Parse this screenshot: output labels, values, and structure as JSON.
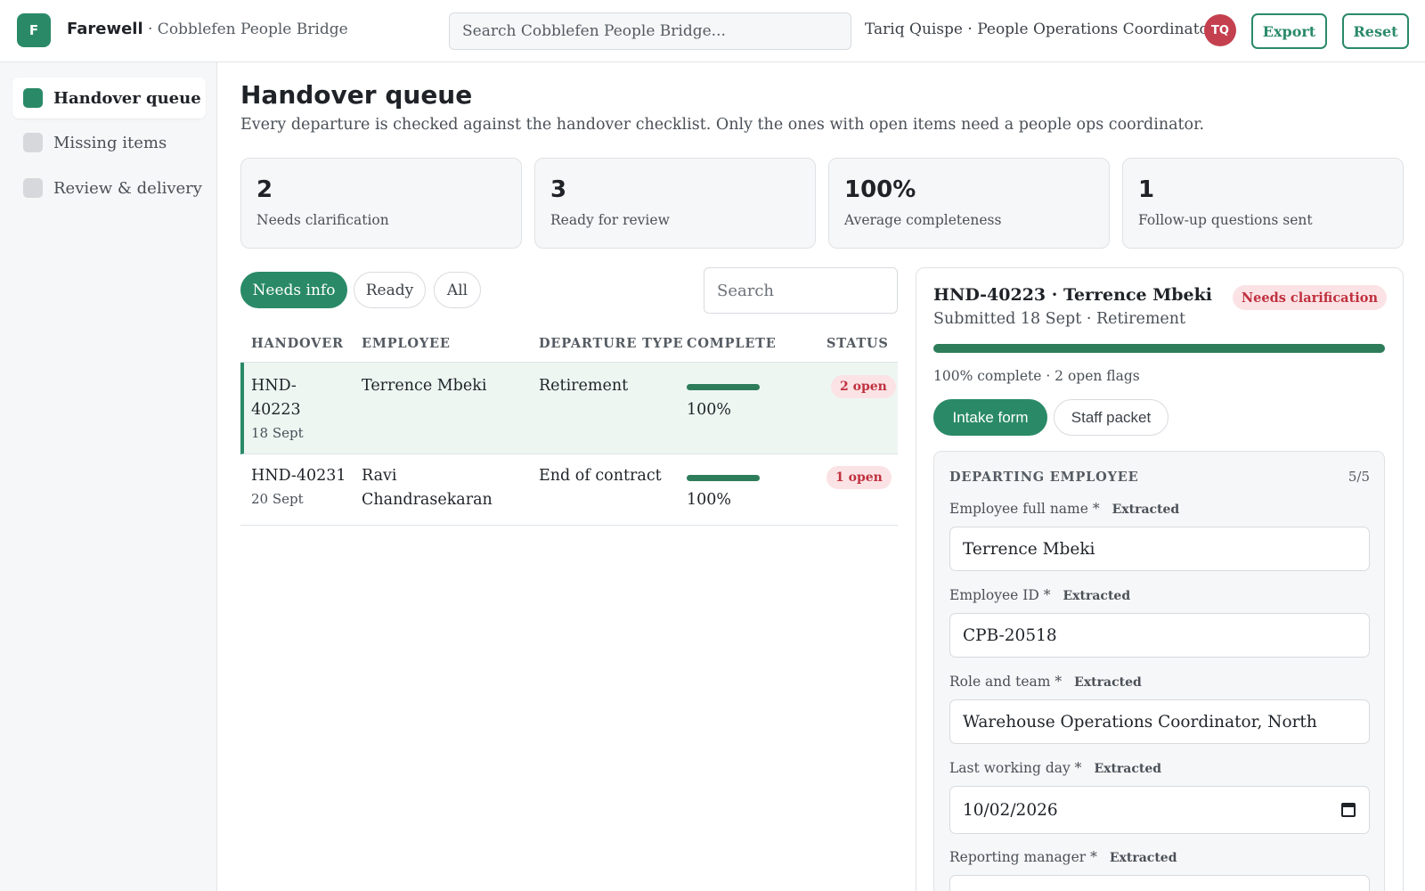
{
  "header": {
    "logo_letter": "F",
    "app_name": "Farewell",
    "org_name": "· Cobblefen People Bridge",
    "search_placeholder": "Search Cobblefen People Bridge...",
    "user_label": "Tariq Quispe · People Operations Coordinator",
    "avatar_initials": "TQ",
    "export_label": "Export",
    "reset_label": "Reset"
  },
  "sidebar": {
    "items": [
      {
        "label": "Handover queue",
        "active": true
      },
      {
        "label": "Missing items",
        "active": false
      },
      {
        "label": "Review & delivery",
        "active": false
      }
    ]
  },
  "main": {
    "title": "Handover queue",
    "subtitle": "Every departure is checked against the handover checklist. Only the ones with open items need a people ops coordinator.",
    "stats": [
      {
        "value": "2",
        "label": "Needs clarification"
      },
      {
        "value": "3",
        "label": "Ready for review"
      },
      {
        "value": "100%",
        "label": "Average completeness"
      },
      {
        "value": "1",
        "label": "Follow-up questions sent"
      }
    ],
    "filters": [
      {
        "label": "Needs info",
        "active": true
      },
      {
        "label": "Ready",
        "active": false
      },
      {
        "label": "All",
        "active": false
      }
    ],
    "table_search_placeholder": "Search",
    "columns": [
      "HANDOVER",
      "EMPLOYEE",
      "DEPARTURE TYPE",
      "COMPLETE",
      "STATUS"
    ],
    "rows": [
      {
        "id_line1": "HND-",
        "id_line2": "40223",
        "date": "18 Sept",
        "employee_line1": "Terrence Mbeki",
        "employee_line2": "",
        "type": "Retirement",
        "complete": 1.0,
        "complete_label": "100%",
        "status": "2 open",
        "selected": true
      },
      {
        "id_line1": "HND-40231",
        "id_line2": "",
        "date": "20 Sept",
        "employee_line1": "Ravi",
        "employee_line2": "Chandrasekaran",
        "type": "End of contract",
        "complete": 1.0,
        "complete_label": "100%",
        "status": "1 open",
        "selected": false
      }
    ]
  },
  "detail": {
    "title": "HND-40223 · Terrence Mbeki",
    "badge": "Needs clarification",
    "subtitle": "Submitted 18 Sept · Retirement",
    "progress": 1.0,
    "meta": "100% complete · 2 open flags",
    "tabs": [
      {
        "label": "Intake form",
        "active": true
      },
      {
        "label": "Staff packet",
        "active": false
      }
    ],
    "section": {
      "title": "DEPARTING EMPLOYEE",
      "count": "5/5",
      "fields": [
        {
          "label": "Employee full name *",
          "tag": "Extracted",
          "value": "Terrence Mbeki"
        },
        {
          "label": "Employee ID *",
          "tag": "Extracted",
          "value": "CPB-20518"
        },
        {
          "label": "Role and team *",
          "tag": "Extracted",
          "value": "Warehouse Operations Coordinator, North"
        },
        {
          "label": "Last working day *",
          "tag": "Extracted",
          "value": "10/02/2026"
        },
        {
          "label": "Reporting manager *",
          "tag": "Extracted",
          "value": ""
        }
      ]
    }
  }
}
